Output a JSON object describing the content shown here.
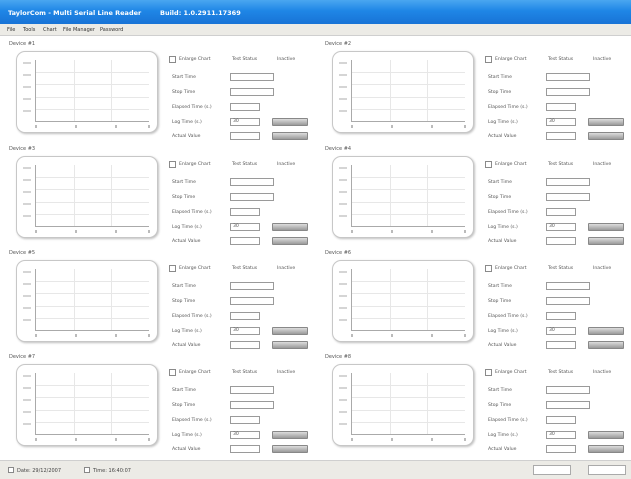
{
  "window": {
    "title": "TaylorCom - Multi Serial Line Reader",
    "build": "Build: 1.0.2911.17369"
  },
  "menu": [
    "File",
    "Tools",
    "Chart",
    "File Manager",
    "Password"
  ],
  "labels": {
    "enlarge_chart": "Enlarge Chart",
    "test_status": "Test Status",
    "start_time": "Start Time",
    "stop_time": "Stop Time",
    "elapsed_time": "Elapsed Time (s.)",
    "log_time": "Log Time (s.)",
    "actual_value": "Actual Value"
  },
  "devices": [
    {
      "title": "Device #1",
      "status": "Inactive",
      "log_time": "30",
      "y_ticks": [
        "125",
        "100",
        "75",
        "50",
        "25"
      ]
    },
    {
      "title": "Device #2",
      "status": "Inactive",
      "log_time": "30",
      "y_ticks": [
        "125",
        "100",
        "75",
        "50",
        "25"
      ]
    },
    {
      "title": "Device #3",
      "status": "Inactive",
      "log_time": "30",
      "y_ticks": [
        "125",
        "100",
        "75",
        "50",
        "25"
      ]
    },
    {
      "title": "Device #4",
      "status": "Inactive",
      "log_time": "30",
      "y_ticks": [
        "125",
        "100",
        "75",
        "50",
        "25"
      ]
    },
    {
      "title": "Device #5",
      "status": "Inactive",
      "log_time": "30",
      "y_ticks": [
        "125",
        "100",
        "75",
        "50",
        "25"
      ]
    },
    {
      "title": "Device #6",
      "status": "Inactive",
      "log_time": "30",
      "y_ticks": [
        "125",
        "100",
        "75",
        "50",
        "25"
      ]
    },
    {
      "title": "Device #7",
      "status": "Inactive",
      "log_time": "30",
      "y_ticks": [
        "125",
        "100",
        "75",
        "50",
        "25"
      ]
    },
    {
      "title": "Device #8",
      "status": "Inactive",
      "log_time": "30",
      "y_ticks": [
        "125",
        "100",
        "75",
        "50",
        "25"
      ]
    }
  ],
  "statusbar": {
    "date": "Date: 29/12/2007",
    "time": "Time: 16:40:07"
  },
  "colors": {
    "titlebar": "#1f86e6",
    "menubar": "#ecebe6",
    "button": "#9a9a9a"
  }
}
